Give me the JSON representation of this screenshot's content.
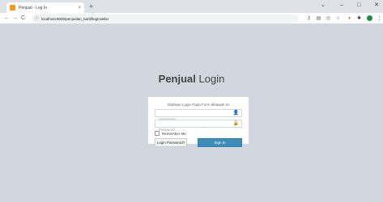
{
  "browser": {
    "tab_title": "Penjual - Log In",
    "tab_close": "×",
    "new_tab": "+",
    "url": "localhost:8000/penjualan_kartil/loginseller",
    "window_controls": {
      "minimize": "⌄",
      "restore": "–",
      "maximize": "□",
      "close": "✕"
    }
  },
  "page": {
    "logo_bold": "Penjual",
    "logo_light": "Login",
    "message": "Silahkan Login Pada Form dibawah Ini",
    "username_placeholder": "Username",
    "password_placeholder": "Password",
    "remember_label": "Remember Me",
    "forgot_label": "Login Password?",
    "signin_label": "Sign In"
  },
  "colors": {
    "page_background": "#d2d6de",
    "primary_button": "#3c8dbc"
  }
}
